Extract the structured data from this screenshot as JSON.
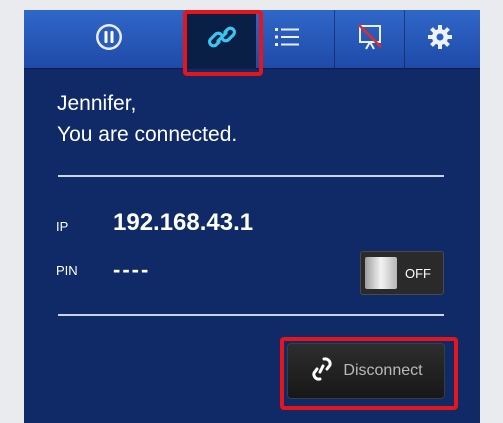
{
  "tabs": [
    {
      "name": "pause",
      "icon": "pause-icon"
    },
    {
      "name": "link",
      "icon": "link-icon",
      "active": true
    },
    {
      "name": "list",
      "icon": "list-icon"
    },
    {
      "name": "presentation-off",
      "icon": "presentation-off-icon"
    },
    {
      "name": "settings",
      "icon": "gear-icon"
    }
  ],
  "greeting": {
    "line1": "Jennifer,",
    "line2": "You are connected."
  },
  "connection": {
    "ip_label": "IP",
    "ip_value": "192.168.43.1",
    "pin_label": "PIN",
    "pin_value": "----"
  },
  "toggle": {
    "state_label": "OFF"
  },
  "disconnect": {
    "label": "Disconnect",
    "icon": "broken-link-icon"
  },
  "colors": {
    "background": "#0f2a66",
    "tabbar": "#2f67c9",
    "highlight": "#e4161c"
  }
}
